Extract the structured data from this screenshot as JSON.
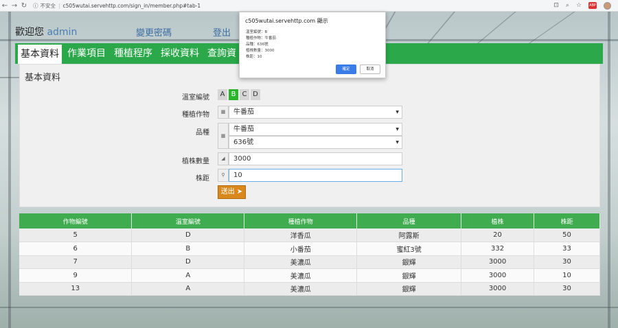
{
  "browser": {
    "security": "不安全",
    "url": "c505wutai.servehttp.com/sign_in/member.php#tab-1"
  },
  "header": {
    "welcome": "歡迎您",
    "username": "admin",
    "change_password": "變更密碼",
    "logout": "登出"
  },
  "tabs": [
    "基本資料",
    "作業項目",
    "種植程序",
    "採收資料",
    "查詢資"
  ],
  "panel": {
    "title": "基本資料",
    "greenhouse_label": "溫室編號",
    "greenhouses": [
      "A",
      "B",
      "C",
      "D"
    ],
    "selected_greenhouse": "B",
    "crop_label": "種植作物",
    "crop_value": "牛番茄",
    "variety_label": "品種",
    "variety_value_1": "牛番茄",
    "variety_value_2": "636號",
    "count_label": "植株數量",
    "count_value": "3000",
    "spacing_label": "株距",
    "spacing_value": "10",
    "submit_label": "送出"
  },
  "table": {
    "headers": [
      "作物編號",
      "溫室編號",
      "種植作物",
      "品種",
      "植株",
      "株距"
    ],
    "rows": [
      [
        "5",
        "D",
        "洋香瓜",
        "阿露斯",
        "20",
        "50"
      ],
      [
        "6",
        "B",
        "小番茄",
        "蜜紅3號",
        "332",
        "33"
      ],
      [
        "7",
        "D",
        "美濃瓜",
        "銀輝",
        "3000",
        "30"
      ],
      [
        "9",
        "A",
        "美濃瓜",
        "銀輝",
        "3000",
        "10"
      ],
      [
        "13",
        "A",
        "美濃瓜",
        "銀輝",
        "3000",
        "30"
      ]
    ]
  },
  "dialog": {
    "title": "c505wutai.servehttp.com 顯示",
    "lines": [
      "溫室編號：B",
      "種植作物：牛番茄",
      "品種：636號",
      "植株數量：3000",
      "株距：10"
    ],
    "ok": "確定",
    "cancel": "取消"
  }
}
